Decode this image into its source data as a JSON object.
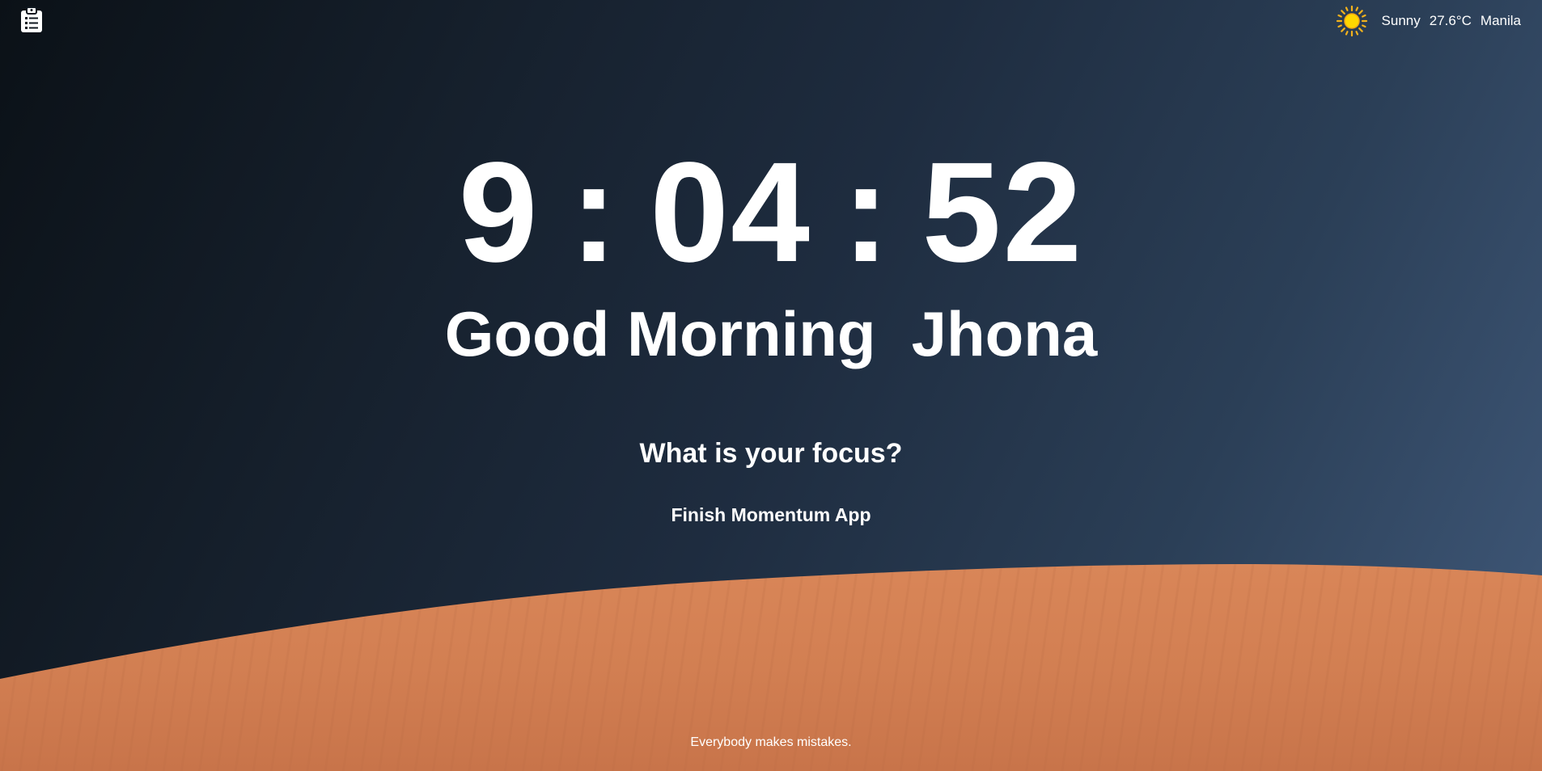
{
  "toolbar": {
    "todo_icon": "clipboard-list-icon"
  },
  "weather": {
    "icon": "sun-icon",
    "condition": "Sunny",
    "temperature": "27.6°C",
    "location": "Manila",
    "sun_color": "#ffcc00"
  },
  "clock": {
    "hours": "9",
    "minutes": "04",
    "seconds": "52",
    "separator": ":"
  },
  "greeting": {
    "salutation": "Good Morning",
    "name": "Jhona"
  },
  "focus": {
    "question": "What is your focus?",
    "task": "Finish Momentum App"
  },
  "quote": {
    "text": "Everybody makes mistakes."
  },
  "colors": {
    "text": "#ffffff",
    "sand": "#d27f52",
    "sky_dark": "#0b1117",
    "sky_light": "#40597a"
  }
}
